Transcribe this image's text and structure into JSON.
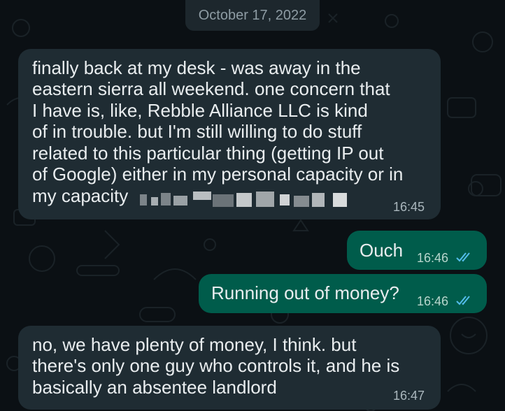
{
  "date_separator": "October 17, 2022",
  "messages": [
    {
      "direction": "incoming",
      "lines": [
        "finally back at my desk - was away in the",
        "eastern sierra all weekend. one concern that",
        "I have is, like, Rebble Alliance LLC is kind",
        "of in trouble. but I'm still willing to do stuff",
        "related to this particular thing (getting IP out",
        "of Google) either in my personal capacity or in",
        "my capacity"
      ],
      "time": "16:45",
      "redacted": true
    },
    {
      "direction": "outgoing",
      "text": "Ouch",
      "time": "16:46",
      "status": "read"
    },
    {
      "direction": "outgoing",
      "text": "Running out of money?",
      "time": "16:46",
      "status": "read"
    },
    {
      "direction": "incoming",
      "lines": [
        "no, we have plenty of money, I think. but",
        "there's only one guy who controls it, and he is",
        "basically an absentee landlord"
      ],
      "time": "16:47"
    }
  ],
  "colors": {
    "background": "#0b1014",
    "incoming_bubble": "#1f2c33",
    "outgoing_bubble": "#005c4b",
    "read_ticks": "#53bdeb"
  }
}
